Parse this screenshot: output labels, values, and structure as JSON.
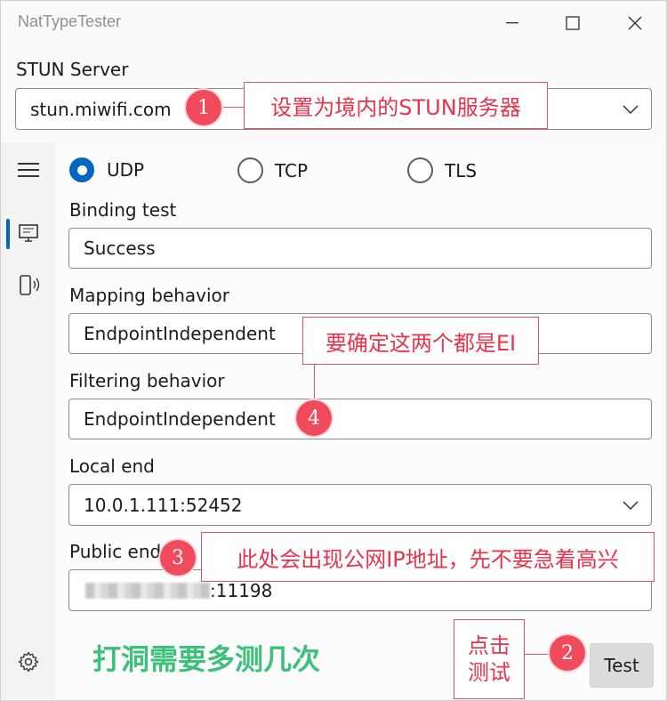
{
  "window": {
    "title": "NatTypeTester"
  },
  "stun": {
    "label": "STUN Server",
    "value": "stun.miwifi.com"
  },
  "protocols": [
    {
      "label": "UDP",
      "selected": true
    },
    {
      "label": "TCP",
      "selected": false
    },
    {
      "label": "TLS",
      "selected": false
    }
  ],
  "binding": {
    "label": "Binding test",
    "value": "Success"
  },
  "mapping": {
    "label": "Mapping behavior",
    "value": "EndpointIndependent"
  },
  "filtering": {
    "label": "Filtering behavior",
    "value": "EndpointIndependent"
  },
  "local": {
    "label": "Local end",
    "value": "10.0.1.111:52452"
  },
  "public": {
    "label": "Public end",
    "value_suffix": ":11198"
  },
  "test_button": {
    "label": "Test"
  },
  "annotations": {
    "a1": {
      "number": "1",
      "text": "设置为境内的STUN服务器"
    },
    "a2": {
      "number": "2",
      "text_line1": "点击",
      "text_line2": "测试"
    },
    "a3": {
      "number": "3",
      "text": "此处会出现公网IP地址，先不要急着高兴"
    },
    "a4": {
      "number": "4",
      "text": "要确定这两个都是EI"
    },
    "note": "打洞需要多测几次"
  },
  "colors": {
    "accent": "#0067c0",
    "annotation_red": "#e8334a",
    "note_green": "#3cc07a"
  },
  "icons": {
    "menu": "hamburger-icon",
    "monitor": "monitor-icon",
    "device": "device-signal-icon",
    "settings": "gear-icon"
  }
}
